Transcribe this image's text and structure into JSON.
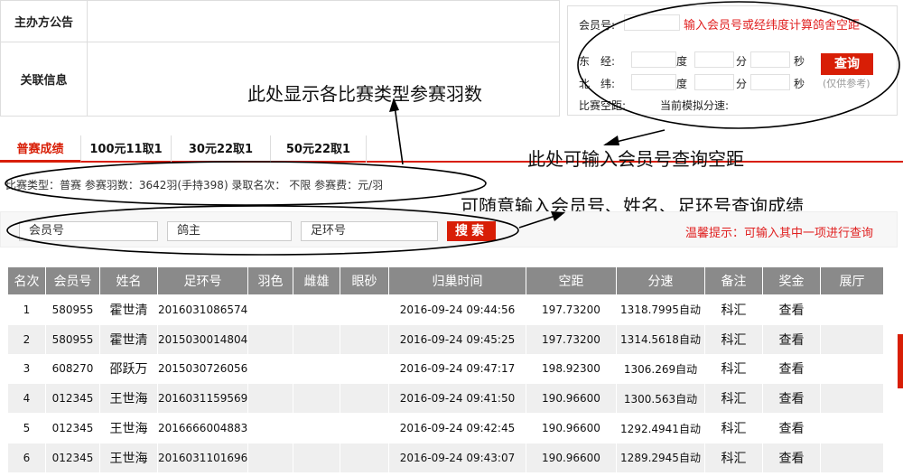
{
  "info": {
    "notice_label": "主办方公告",
    "related_label": "关联信息"
  },
  "annotations": {
    "types_note": "此处显示各比赛类型参赛羽数",
    "distance_note": "此处可输入会员号查询空距",
    "search_note": "可随意输入会员号、姓名、足环号查询成绩"
  },
  "query": {
    "member_label": "会员号:",
    "member_hint": "输入会员号或经纬度计算鸽舍空距",
    "east_label": "东　经:",
    "north_label": "北　纬:",
    "deg": "度",
    "min": "分",
    "sec": "秒",
    "button": "查询",
    "button_sub": "(仅供参考)",
    "distance_label": "比赛空距:",
    "speed_label": "当前模拟分速:"
  },
  "tabs": [
    {
      "label": "普赛成绩"
    },
    {
      "label": "100元11取1"
    },
    {
      "label": "30元22取1"
    },
    {
      "label": "50元22取1"
    }
  ],
  "summary": "比赛类型：普赛  参赛羽数：3642羽(手持398)  录取名次：  不限  参赛费：元/羽",
  "search": {
    "member": "会员号",
    "owner": "鸽主",
    "ring": "足环号",
    "button": "搜索",
    "tip": "温馨提示：可输入其中一项进行查询"
  },
  "table": {
    "headers": [
      "名次",
      "会员号",
      "姓名",
      "足环号",
      "羽色",
      "雌雄",
      "眼砂",
      "归巢时间",
      "空距",
      "分速",
      "备注",
      "奖金",
      "展厅"
    ],
    "rows": [
      [
        "1",
        "580955",
        "霍世清",
        "2016031086574",
        "",
        "",
        "",
        "2016-09-24 09:44:56",
        "197.73200",
        "1318.7995自动",
        "科汇",
        "查看",
        ""
      ],
      [
        "2",
        "580955",
        "霍世清",
        "2015030014804",
        "",
        "",
        "",
        "2016-09-24 09:45:25",
        "197.73200",
        "1314.5618自动",
        "科汇",
        "查看",
        ""
      ],
      [
        "3",
        "608270",
        "邵跃万",
        "2015030726056",
        "",
        "",
        "",
        "2016-09-24 09:47:17",
        "198.92300",
        "1306.269自动",
        "科汇",
        "查看",
        ""
      ],
      [
        "4",
        "012345",
        "王世海",
        "2016031159569",
        "",
        "",
        "",
        "2016-09-24 09:41:50",
        "190.96600",
        "1300.563自动",
        "科汇",
        "查看",
        ""
      ],
      [
        "5",
        "012345",
        "王世海",
        "2016666004883",
        "",
        "",
        "",
        "2016-09-24 09:42:45",
        "190.96600",
        "1292.4941自动",
        "科汇",
        "查看",
        ""
      ],
      [
        "6",
        "012345",
        "王世海",
        "2016031101696",
        "",
        "",
        "",
        "2016-09-24 09:43:07",
        "190.96600",
        "1289.2945自动",
        "科汇",
        "查看",
        ""
      ]
    ]
  },
  "colors": {
    "accent": "#d81e06",
    "header_bg": "#8a8a8a"
  }
}
